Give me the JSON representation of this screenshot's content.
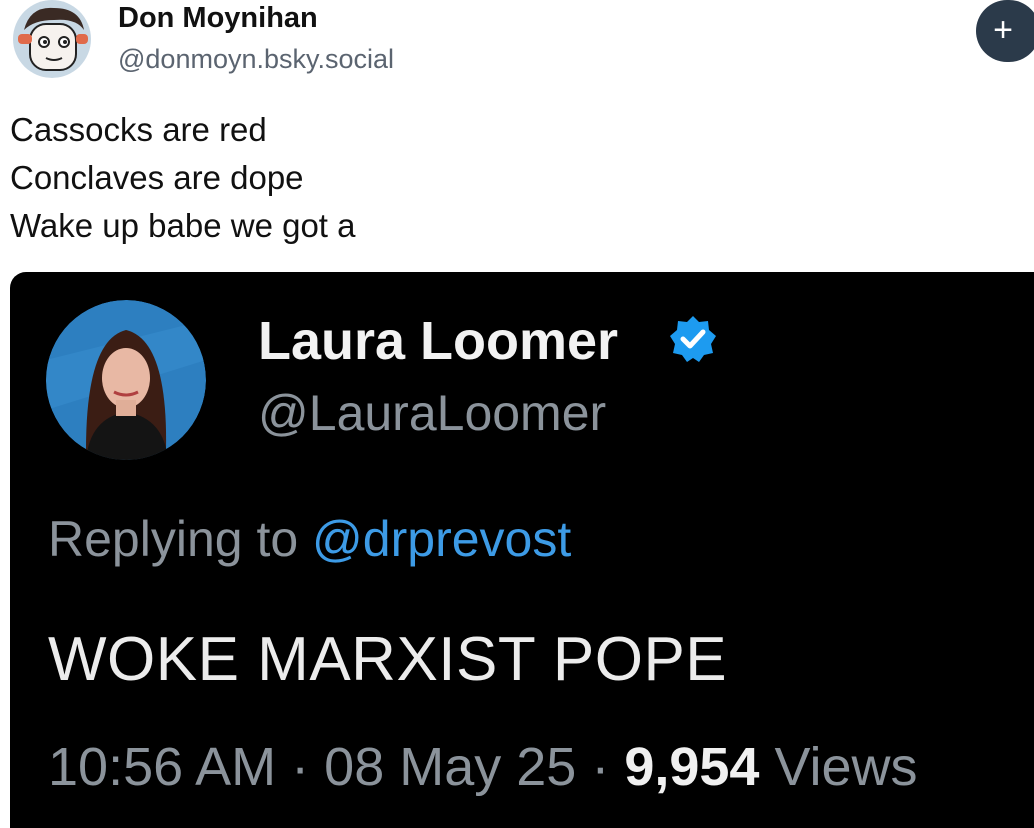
{
  "post": {
    "author_name": "Don Moynihan",
    "author_handle": "@donmoyn.bsky.social",
    "follow_label": "+",
    "lines": [
      "Cassocks are red",
      "Conclaves are dope",
      "Wake up babe we got a"
    ]
  },
  "embed": {
    "name": "Laura Loomer",
    "handle": "@LauraLoomer",
    "replying_prefix": "Replying to ",
    "replying_mention": "@drprevost",
    "text": "WOKE MARXIST POPE",
    "time": "10:56 AM",
    "separator": " · ",
    "date": "08 May 25",
    "views_count": "9,954",
    "views_label": " Views",
    "verified_color": "#1d9bf0"
  }
}
